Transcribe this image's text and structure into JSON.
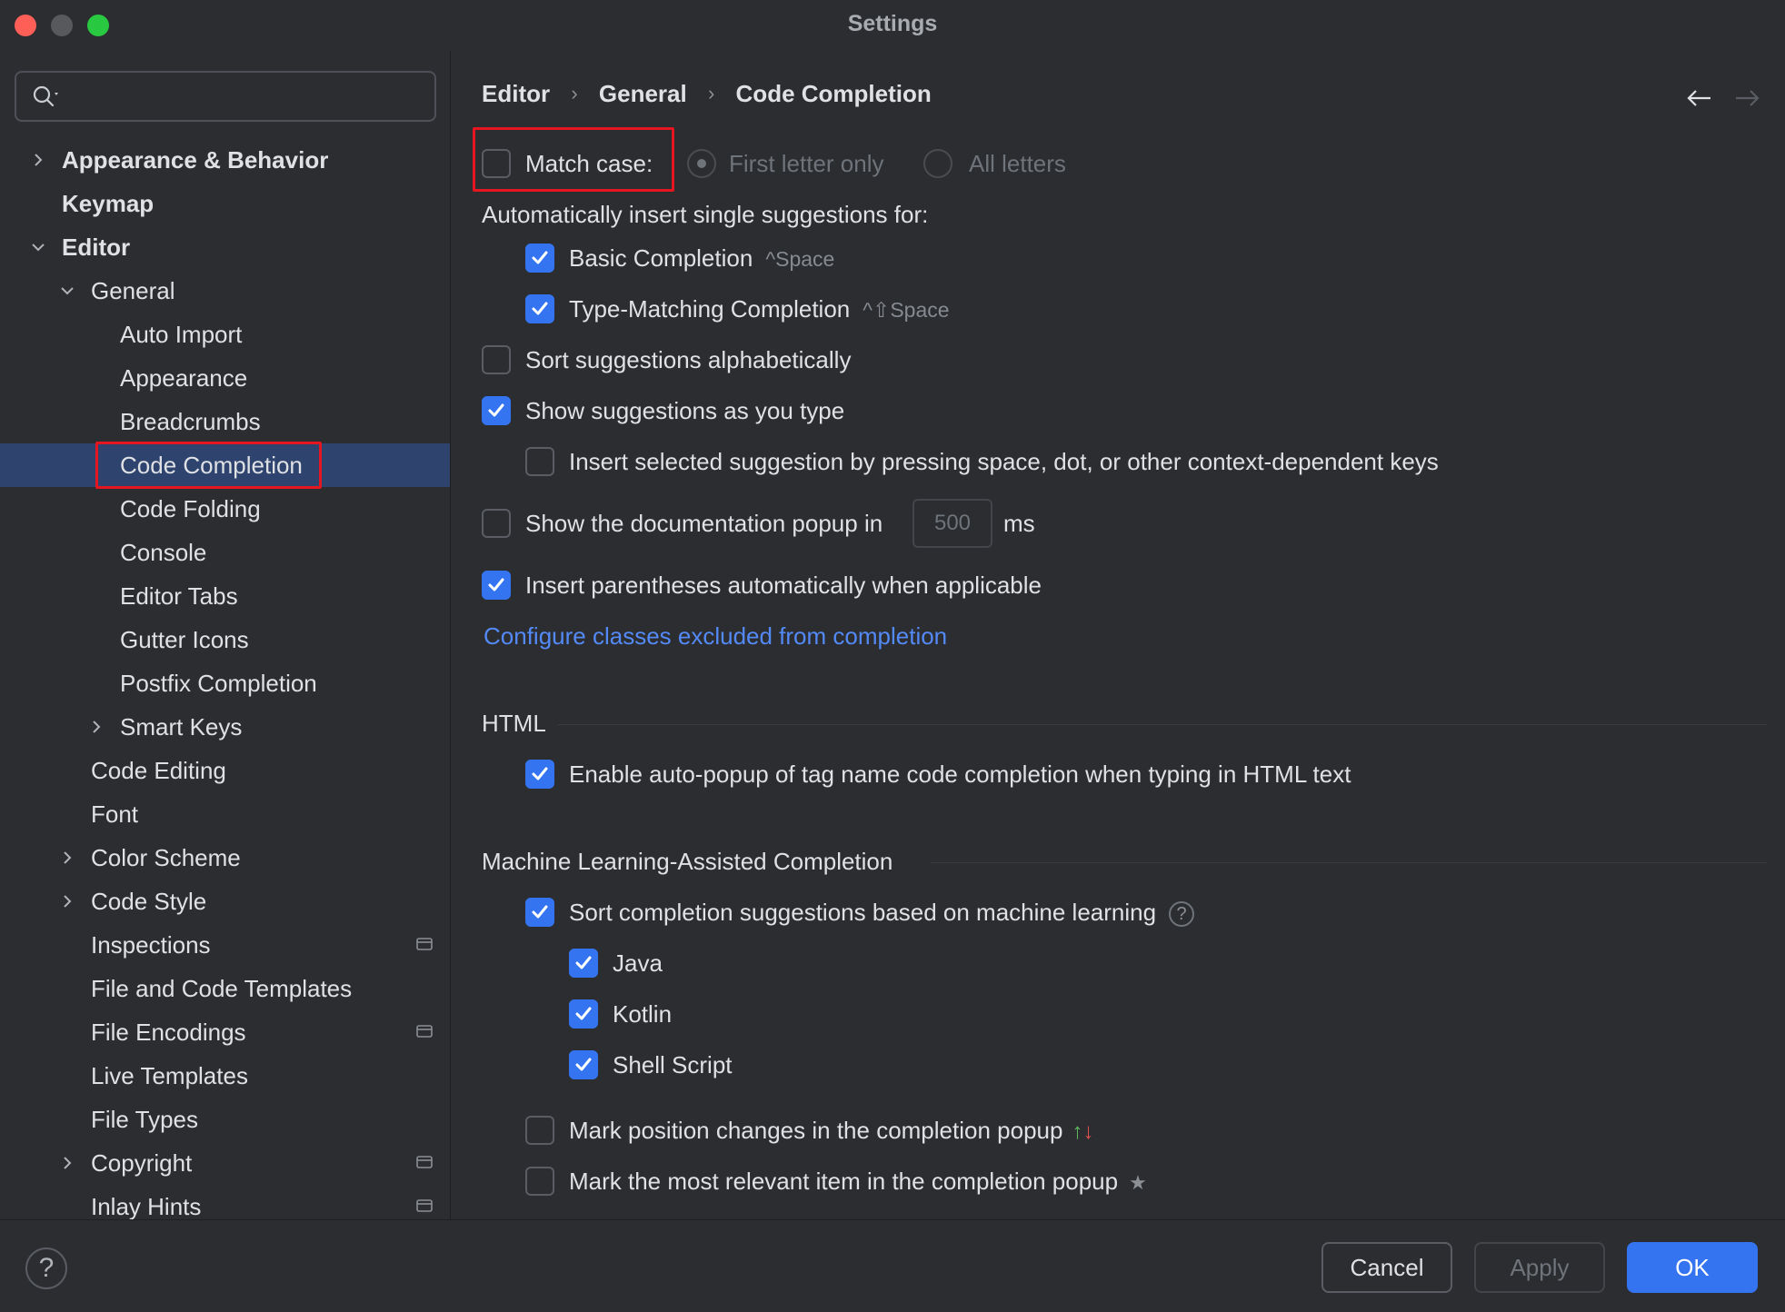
{
  "window": {
    "title": "Settings"
  },
  "search": {
    "value": "",
    "placeholder": ""
  },
  "sidebar": {
    "items": [
      {
        "label": "Appearance & Behavior",
        "level": 0,
        "bold": true,
        "expander": "collapsed"
      },
      {
        "label": "Keymap",
        "level": 0,
        "bold": true,
        "expander": "none"
      },
      {
        "label": "Editor",
        "level": 0,
        "bold": true,
        "expander": "expanded"
      },
      {
        "label": "General",
        "level": 1,
        "bold": false,
        "expander": "expanded"
      },
      {
        "label": "Auto Import",
        "level": 2,
        "bold": false,
        "expander": "none"
      },
      {
        "label": "Appearance",
        "level": 2,
        "bold": false,
        "expander": "none"
      },
      {
        "label": "Breadcrumbs",
        "level": 2,
        "bold": false,
        "expander": "none"
      },
      {
        "label": "Code Completion",
        "level": 2,
        "bold": false,
        "expander": "none",
        "selected": true
      },
      {
        "label": "Code Folding",
        "level": 2,
        "bold": false,
        "expander": "none"
      },
      {
        "label": "Console",
        "level": 2,
        "bold": false,
        "expander": "none"
      },
      {
        "label": "Editor Tabs",
        "level": 2,
        "bold": false,
        "expander": "none"
      },
      {
        "label": "Gutter Icons",
        "level": 2,
        "bold": false,
        "expander": "none"
      },
      {
        "label": "Postfix Completion",
        "level": 2,
        "bold": false,
        "expander": "none"
      },
      {
        "label": "Smart Keys",
        "level": 2,
        "bold": false,
        "expander": "collapsed"
      },
      {
        "label": "Code Editing",
        "level": 1,
        "bold": false,
        "expander": "none"
      },
      {
        "label": "Font",
        "level": 1,
        "bold": false,
        "expander": "none"
      },
      {
        "label": "Color Scheme",
        "level": 1,
        "bold": false,
        "expander": "collapsed"
      },
      {
        "label": "Code Style",
        "level": 1,
        "bold": false,
        "expander": "collapsed"
      },
      {
        "label": "Inspections",
        "level": 1,
        "bold": false,
        "expander": "none",
        "project_icon": true
      },
      {
        "label": "File and Code Templates",
        "level": 1,
        "bold": false,
        "expander": "none"
      },
      {
        "label": "File Encodings",
        "level": 1,
        "bold": false,
        "expander": "none",
        "project_icon": true
      },
      {
        "label": "Live Templates",
        "level": 1,
        "bold": false,
        "expander": "none"
      },
      {
        "label": "File Types",
        "level": 1,
        "bold": false,
        "expander": "none"
      },
      {
        "label": "Copyright",
        "level": 1,
        "bold": false,
        "expander": "collapsed",
        "project_icon": true
      },
      {
        "label": "Inlay Hints",
        "level": 1,
        "bold": false,
        "expander": "none",
        "project_icon": true
      }
    ]
  },
  "breadcrumb": {
    "items": [
      "Editor",
      "General",
      "Code Completion"
    ]
  },
  "content": {
    "match_case": {
      "label": "Match case:",
      "checked": false
    },
    "radio_first": {
      "label": "First letter only",
      "selected": true,
      "enabled": false
    },
    "radio_all": {
      "label": "All letters",
      "selected": false,
      "enabled": false
    },
    "auto_insert_heading": "Automatically insert single suggestions for:",
    "basic_completion": {
      "label": "Basic Completion",
      "shortcut": "^Space",
      "checked": true
    },
    "type_matching": {
      "label": "Type-Matching Completion",
      "shortcut": "^⇧Space",
      "checked": true
    },
    "sort_alpha": {
      "label": "Sort suggestions alphabetically",
      "checked": false
    },
    "show_suggestions": {
      "label": "Show suggestions as you type",
      "checked": true
    },
    "insert_selected": {
      "label": "Insert selected suggestion by pressing space, dot, or other context-dependent keys",
      "checked": false
    },
    "doc_popup": {
      "label": "Show the documentation popup in",
      "value": "500",
      "unit": "ms",
      "checked": false
    },
    "insert_parens": {
      "label": "Insert parentheses automatically when applicable",
      "checked": true
    },
    "configure_link": "Configure classes excluded from completion",
    "html_section": "HTML",
    "html_autopopup": {
      "label": "Enable auto-popup of tag name code completion when typing in HTML text",
      "checked": true
    },
    "ml_section": "Machine Learning-Assisted Completion",
    "ml_sort": {
      "label": "Sort completion suggestions based on machine learning",
      "checked": true
    },
    "ml_java": {
      "label": "Java",
      "checked": true
    },
    "ml_kotlin": {
      "label": "Kotlin",
      "checked": true
    },
    "ml_shell": {
      "label": "Shell Script",
      "checked": true
    },
    "mark_position": {
      "label": "Mark position changes in the completion popup",
      "checked": false
    },
    "mark_relevant": {
      "label": "Mark the most relevant item in the completion popup",
      "checked": false
    }
  },
  "footer": {
    "help": "?",
    "cancel": "Cancel",
    "apply": "Apply",
    "ok": "OK"
  },
  "colors": {
    "accent": "#3574f0",
    "link": "#548af7",
    "selection": "#2e436e",
    "highlight_box": "#e5161f",
    "arrow_up": "#5fb85f",
    "arrow_down": "#e0504f"
  }
}
